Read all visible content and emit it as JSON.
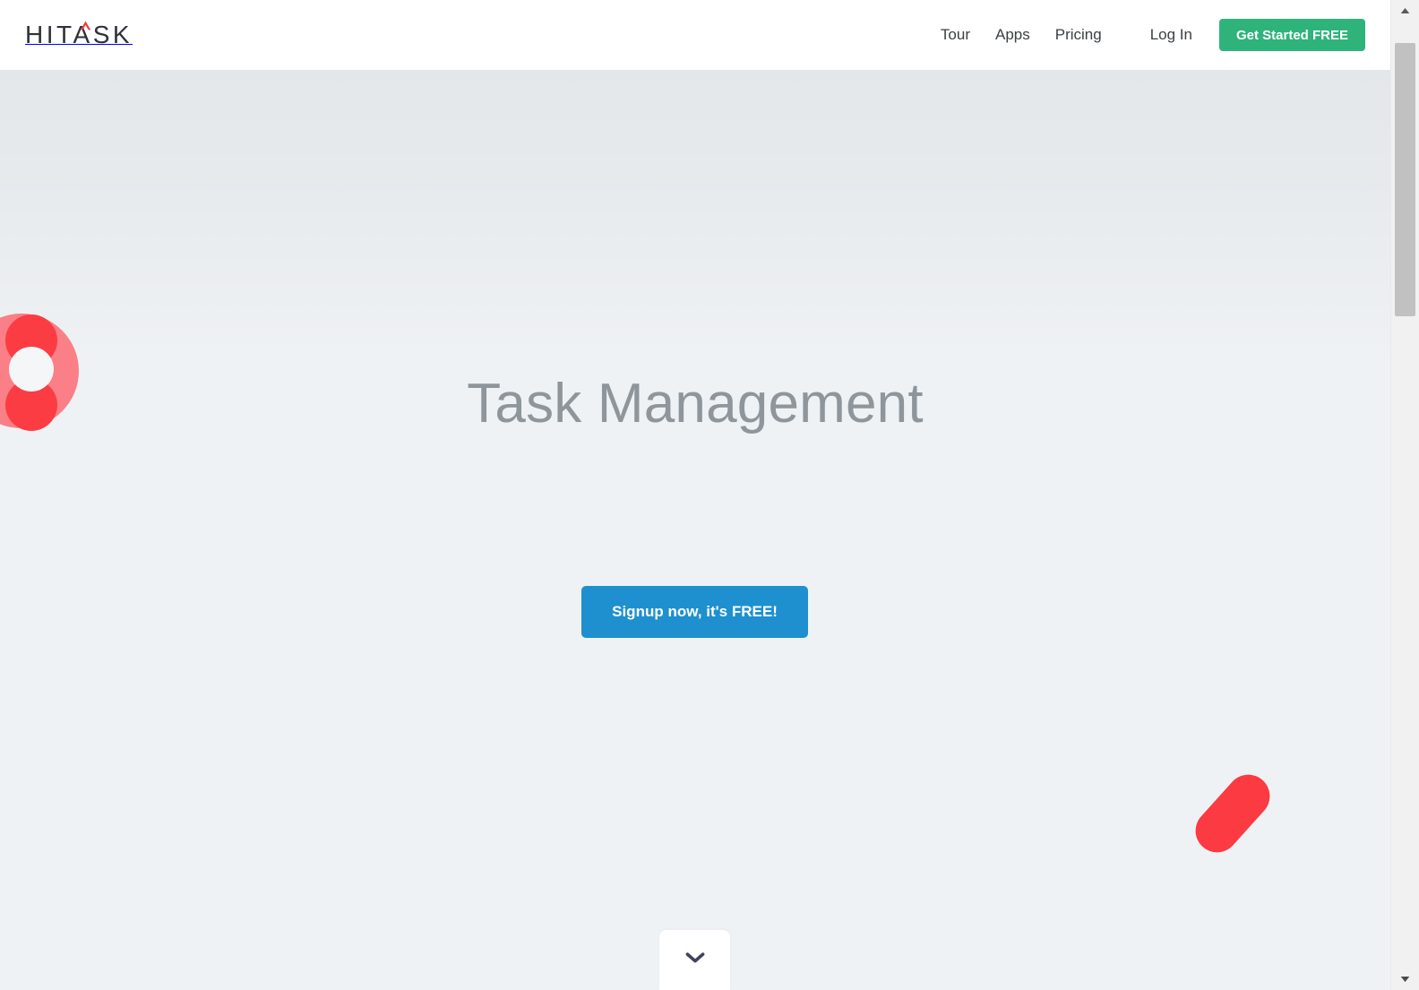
{
  "page": {
    "background_top": "#e3e7ea",
    "background_bottom": "#eff2f5"
  },
  "header": {
    "logo_text": "HITASK",
    "logo_accent_color": "#ef3b42",
    "logo_text_color": "#2f3138",
    "nav_items": [
      {
        "label": "Tour",
        "name": "nav-link-tour"
      },
      {
        "label": "Apps",
        "name": "nav-link-apps"
      },
      {
        "label": "Pricing",
        "name": "nav-link-pricing"
      }
    ],
    "login_label": "Log In",
    "cta_label": "Get Started FREE",
    "cta_color": "#2eb37b"
  },
  "hero": {
    "title": "Task Management",
    "title_color": "#8e969c",
    "cta_label": "Signup now, it's FREE!",
    "cta_color": "#1e90cf",
    "scroll_down_icon": "chevron-down-icon",
    "scroll_down_icon_color": "#3f4260",
    "decorations": {
      "left_circle_group": {
        "big_circle_color": "#fa7f86",
        "accent_circle_color": "#fc3c43",
        "inner_circle_color": "#f4f6f8"
      },
      "right_capsule": {
        "color": "#fc3a41",
        "rotation_degrees": 42
      }
    }
  },
  "browser_chrome": {
    "scrollbar": {
      "track_color": "#f1f1f1",
      "thumb_color": "#c1c1c1",
      "up_arrow_icon": "arrow-up-icon",
      "down_arrow_icon": "arrow-down-icon"
    }
  }
}
